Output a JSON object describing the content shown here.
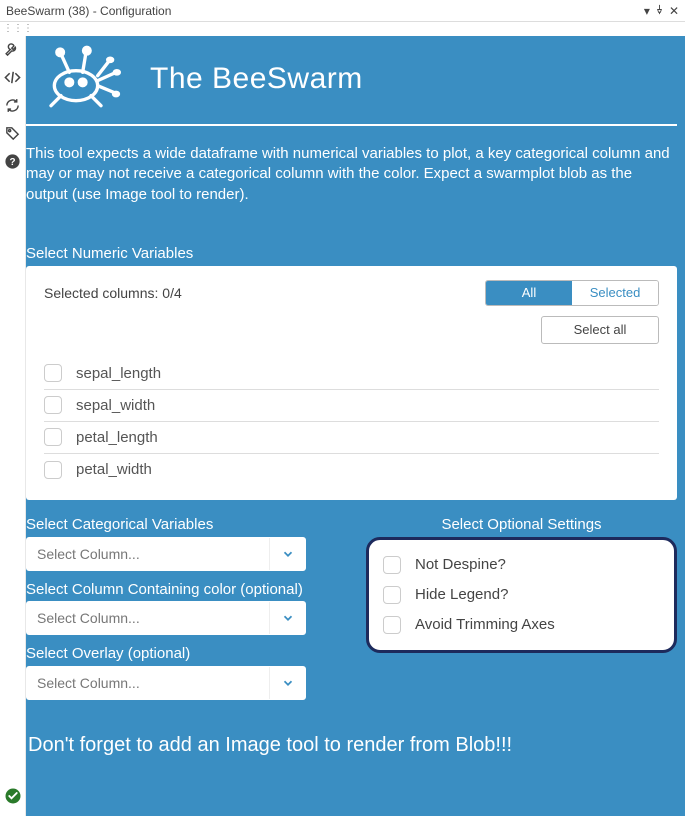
{
  "window": {
    "title": "BeeSwarm (38) - Configuration"
  },
  "header": {
    "app_title": "The BeeSwarm"
  },
  "description": "This tool expects a wide dataframe with numerical variables to plot, a key categorical column and may or may not receive a categorical column with the color. Expect a swarmplot blob as the output (use Image tool to render).",
  "numeric": {
    "section_label": "Select Numeric Variables",
    "selected_count_label": "Selected columns: 0/4",
    "seg_all": "All",
    "seg_selected": "Selected",
    "select_all_btn": "Select all",
    "columns": [
      "sepal_length",
      "sepal_width",
      "petal_length",
      "petal_width"
    ]
  },
  "categorical": {
    "cat_label": "Select Categorical Variables",
    "color_label": "Select Column Containing color (optional)",
    "overlay_label": "Select Overlay (optional)",
    "placeholder": "Select Column..."
  },
  "optional": {
    "title": "Select Optional Settings",
    "items": [
      "Not Despine?",
      "Hide Legend?",
      "Avoid Trimming Axes"
    ]
  },
  "footer": "Don't forget to add an Image tool to render from Blob!!!"
}
